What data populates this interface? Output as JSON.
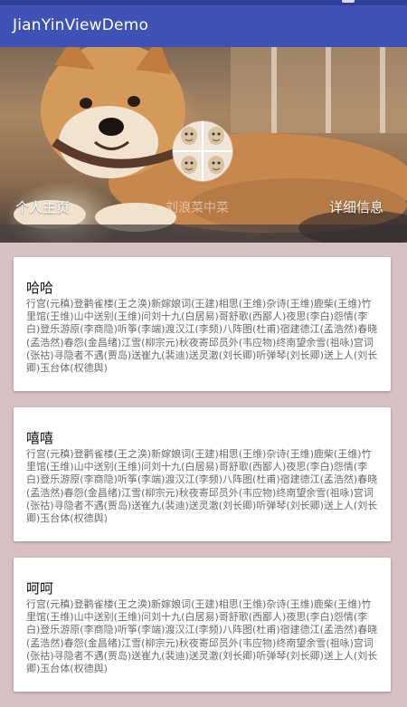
{
  "app": {
    "title": "JianYinViewDemo"
  },
  "header": {
    "left_link": "个人主页",
    "center_name": "刘浪菜中菜",
    "right_link": "详细信息"
  },
  "cards": [
    {
      "title": "哈哈",
      "body": "行宫(元稹)登鹳雀楼(王之涣)新嫁娘词(王建)相思(王维)杂诗(王维)鹿柴(王维)竹里馆(王维)山中送别(王维)问刘十九(白居易)哥舒歌(西鄙人)夜思(李白)怨情(李白)登乐游原(李商隐)听筝(李端)渡汉江(李频)八阵图(杜甫)宿建德江(孟浩然)春晓(孟浩然)春怨(金昌绪)江雪(柳宗元)秋夜寄邱员外(韦应物)终南望余雪(祖咏)宫词(张祜)寻隐者不遇(贾岛)送崔九(裴迪)送灵澈(刘长卿)听弹琴(刘长卿)送上人(刘长卿)玉台体(权德舆)"
    },
    {
      "title": "嘻嘻",
      "body": "行宫(元稹)登鹳雀楼(王之涣)新嫁娘词(王建)相思(王维)杂诗(王维)鹿柴(王维)竹里馆(王维)山中送别(王维)问刘十九(白居易)哥舒歌(西鄙人)夜思(李白)怨情(李白)登乐游原(李商隐)听筝(李端)渡汉江(李频)八阵图(杜甫)宿建德江(孟浩然)春晓(孟浩然)春怨(金昌绪)江雪(柳宗元)秋夜寄邱员外(韦应物)终南望余雪(祖咏)宫词(张祜)寻隐者不遇(贾岛)送崔九(裴迪)送灵澈(刘长卿)听弹琴(刘长卿)送上人(刘长卿)玉台体(权德舆)"
    },
    {
      "title": "呵呵",
      "body": "行宫(元稹)登鹳雀楼(王之涣)新嫁娘词(王建)相思(王维)杂诗(王维)鹿柴(王维)竹里馆(王维)山中送别(王维)问刘十九(白居易)哥舒歌(西鄙人)夜思(李白)怨情(李白)登乐游原(李商隐)听筝(李端)渡汉江(李频)八阵图(杜甫)宿建德江(孟浩然)春晓(孟浩然)春怨(金昌绪)江雪(柳宗元)秋夜寄邱员外(韦应物)终南望余雪(祖咏)宫词(张祜)寻隐者不遇(贾岛)送崔九(裴迪)送灵澈(刘长卿)听弹琴(刘长卿)送上人(刘长卿)玉台体(权德舆)"
    }
  ],
  "colors": {
    "app_bar": "#3f51b5",
    "status_bar": "#2f3f9b",
    "page_background": "#d6c2c4",
    "card_background": "#ffffff"
  }
}
